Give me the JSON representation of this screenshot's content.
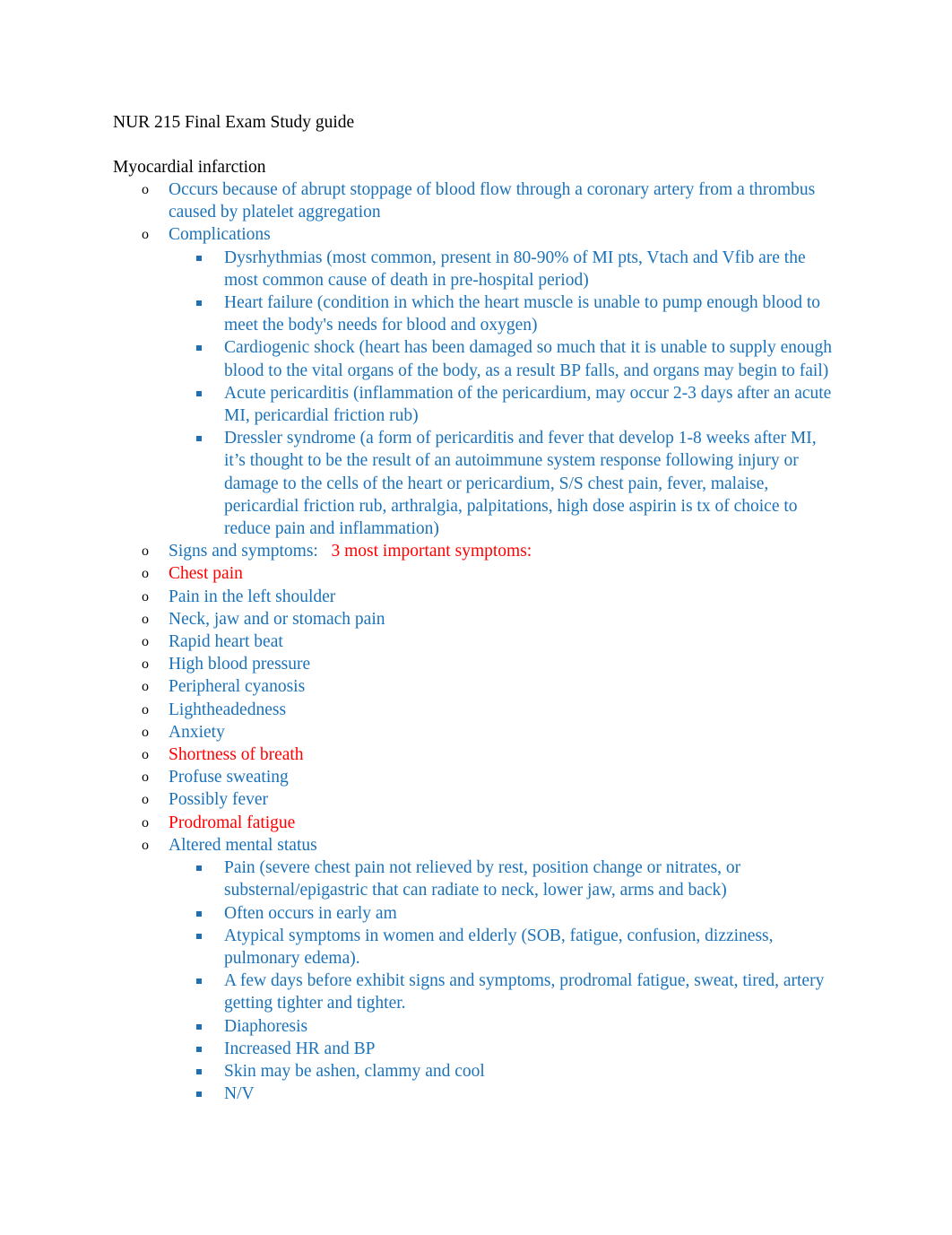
{
  "document": {
    "title": "NUR 215 Final Exam Study guide",
    "section_heading": "Myocardial infarction"
  },
  "colors": {
    "blue": "#1B72B8",
    "red": "#FF0000",
    "black": "#000000",
    "page_background": "#FFFFFF"
  },
  "bullets": {
    "level1_glyph": "o",
    "level2_glyph": "square"
  },
  "outline": {
    "occurs": "Occurs because of abrupt stoppage of blood flow through a coronary artery from a thrombus caused by platelet aggregation",
    "complications_label": "Complications",
    "complications": [
      "Dysrhythmias (most common, present in 80-90% of MI pts, Vtach and Vfib are the most common cause of death in pre-hospital period)",
      "Heart failure (condition in which the heart muscle is unable to pump enough blood to meet the body's needs for blood and oxygen)",
      "Cardiogenic shock (heart has been damaged so much that it is unable to supply enough blood to the vital organs of the body, as a result BP falls, and organs may begin to fail)",
      "Acute pericarditis (inflammation of the pericardium, may occur 2-3 days after an acute MI, pericardial friction rub)",
      "Dressler syndrome (a form of pericarditis and fever that develop 1-8 weeks after MI, it’s thought to be the result of an autoimmune system response following injury or damage to the cells of the heart or pericardium, S/S chest pain, fever, malaise, pericardial friction rub, arthralgia, palpitations, high dose aspirin is tx of choice to reduce pain and inflammation)"
    ],
    "signs_label": "Signs and symptoms:",
    "signs_note": "3 most important symptoms:",
    "symptoms": [
      {
        "text": "Chest pain",
        "color": "red"
      },
      {
        "text": "Pain in the left shoulder",
        "color": "blue"
      },
      {
        "text": "Neck, jaw and or stomach pain",
        "color": "blue"
      },
      {
        "text": "Rapid heart beat",
        "color": "blue"
      },
      {
        "text": "High blood pressure",
        "color": "blue"
      },
      {
        "text": "Peripheral cyanosis",
        "color": "blue"
      },
      {
        "text": "Lightheadedness",
        "color": "blue"
      },
      {
        "text": "Anxiety",
        "color": "blue"
      },
      {
        "text": "Shortness of breath",
        "color": "red"
      },
      {
        "text": "Profuse sweating",
        "color": "blue"
      },
      {
        "text": "Possibly fever",
        "color": "blue"
      },
      {
        "text": "Prodromal fatigue",
        "color": "red"
      },
      {
        "text": "Altered mental status",
        "color": "blue"
      }
    ],
    "symptom_details": [
      "Pain (severe chest pain not relieved by rest, position change or nitrates, or substernal/epigastric that can radiate to neck, lower jaw, arms and back)",
      "Often occurs in early am",
      "Atypical symptoms in women and elderly (SOB, fatigue, confusion, dizziness, pulmonary edema).",
      "A few days before exhibit signs and symptoms, prodromal fatigue, sweat, tired, artery getting tighter and tighter.",
      "Diaphoresis",
      "Increased HR and BP",
      "Skin may be ashen, clammy and cool",
      "N/V"
    ]
  }
}
